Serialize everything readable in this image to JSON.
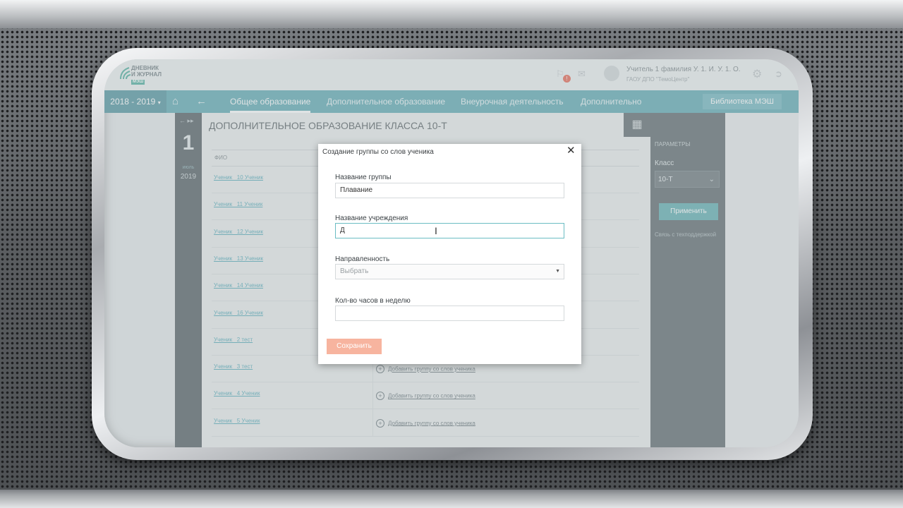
{
  "header": {
    "logo_line1": "ДНЕВНИК",
    "logo_line2": "И ЖУРНАЛ",
    "logo_badge": "МЭШ",
    "notification_count": "!",
    "user_name": "Учитель 1 фамилия У. 1. И. У. 1. О.",
    "user_org": "ГАОУ ДПО \"ТемоЦентр\""
  },
  "nav": {
    "year": "2018 - 2019",
    "items": [
      "Общее образование",
      "Дополнительное образование",
      "Внеурочная деятельность",
      "Дополнительно"
    ],
    "active_index": 0,
    "library_button": "Библиотека МЭШ"
  },
  "date": {
    "day": "1",
    "month": "июль",
    "year": "2019"
  },
  "content": {
    "title": "ДОПОЛНИТЕЛЬНОЕ ОБРАЗОВАНИЕ КЛАССА 10-Т",
    "column_fio": "ФИО",
    "students": [
      "Ученик _10 Ученик",
      "Ученик _11 Ученик",
      "Ученик _12 Ученик",
      "Ученик _13 Ученик",
      "Ученик _14 Ученик",
      "Ученик _16 Ученик",
      "Ученик _2 тест",
      "Ученик _3 тест",
      "Ученик _4 Ученик",
      "Ученик _5 Ученик"
    ],
    "add_group_label": "Добавить группу со слов ученика"
  },
  "params": {
    "title": "ПАРАМЕТРЫ",
    "class_label": "Класс",
    "class_value": "10-Т",
    "apply_button": "Применить",
    "support_link": "Связь с техподдержкой"
  },
  "modal": {
    "title": "Создание группы со слов ученика",
    "close_symbol": "✕",
    "group_name_label": "Название группы",
    "group_name_value": "Плавание",
    "institution_label": "Название учреждения",
    "institution_value": "Д",
    "direction_label": "Направленность",
    "direction_placeholder": "Выбрать",
    "hours_label": "Кол-во часов в неделю",
    "hours_value": "",
    "save_button": "Сохранить"
  },
  "colors": {
    "nav_bg": "#4b9eaa",
    "dark_panel": "#4b575c",
    "link": "#3f9fb0",
    "save_button": "#f7b49f",
    "badge": "#e5533c"
  },
  "icons": {
    "home": "home-icon",
    "back": "arrow-left-icon",
    "grid": "grid-icon",
    "settings": "gear-icon",
    "exit": "logout-icon",
    "mail": "mail-icon",
    "chat": "chat-icon",
    "close": "close-icon",
    "add": "plus-circle-icon"
  }
}
